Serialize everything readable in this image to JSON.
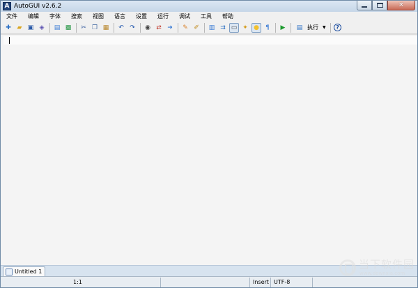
{
  "window": {
    "title": "AutoGUI v2.6.2",
    "app_icon": "A",
    "controls": {
      "minimize": "minimize-icon",
      "maximize": "maximize-icon",
      "close": "✕"
    }
  },
  "menu": {
    "items": [
      "文件",
      "编辑",
      "字体",
      "搜索",
      "视图",
      "语言",
      "设置",
      "运行",
      "调试",
      "工具",
      "帮助"
    ]
  },
  "toolbar": {
    "groups": [
      [
        {
          "name": "new-file-icon",
          "glyph": "✚",
          "color": "#2a6fc4"
        },
        {
          "name": "open-folder-icon",
          "glyph": "▰",
          "color": "#d9a520"
        },
        {
          "name": "save-icon",
          "glyph": "▣",
          "color": "#2b5aa8"
        },
        {
          "name": "save-all-icon",
          "glyph": "◈",
          "color": "#5a4fb0"
        }
      ],
      [
        {
          "name": "form-designer-icon",
          "glyph": "▤",
          "color": "#3a7bd5"
        },
        {
          "name": "import-icon",
          "glyph": "▩",
          "color": "#2f9a4b"
        }
      ],
      [
        {
          "name": "cut-icon",
          "glyph": "✂",
          "color": "#3a5fa0"
        },
        {
          "name": "copy-icon",
          "glyph": "❐",
          "color": "#4a6fa5"
        },
        {
          "name": "paste-icon",
          "glyph": "▦",
          "color": "#b8862b"
        }
      ],
      [
        {
          "name": "undo-icon",
          "glyph": "↶",
          "color": "#2a5db0"
        },
        {
          "name": "redo-icon",
          "glyph": "↷",
          "color": "#2a5db0"
        }
      ],
      [
        {
          "name": "find-icon",
          "glyph": "◉",
          "color": "#404040"
        },
        {
          "name": "replace-icon",
          "glyph": "⇄",
          "color": "#c0392b"
        },
        {
          "name": "goto-icon",
          "glyph": "➜",
          "color": "#3a7bd5"
        }
      ],
      [
        {
          "name": "highlight-icon",
          "glyph": "✎",
          "color": "#d9822b"
        },
        {
          "name": "marker-icon",
          "glyph": "✐",
          "color": "#c08a1e"
        }
      ],
      [
        {
          "name": "toggle-panel-icon",
          "glyph": "▥",
          "color": "#3a7bd5"
        },
        {
          "name": "word-wrap-icon",
          "glyph": "⇉",
          "color": "#2a6fc4"
        },
        {
          "name": "whitespace-icon",
          "glyph": "▭",
          "color": "#555555",
          "pressed": true
        },
        {
          "name": "extensions-icon",
          "glyph": "✦",
          "color": "#d49a1a"
        },
        {
          "name": "tip-icon",
          "glyph": "●",
          "color": "#f2c12e",
          "pressed": true
        },
        {
          "name": "paragraph-icon",
          "glyph": "¶",
          "color": "#3a7bd5"
        }
      ],
      [
        {
          "name": "run-icon",
          "glyph": "▶",
          "color": "#1c9a2e"
        }
      ]
    ],
    "run_button": {
      "icon": "execute-icon",
      "label": "执行",
      "arrow": "▼"
    },
    "help": {
      "name": "help-icon",
      "glyph": "?",
      "color": "#1e4fa0"
    }
  },
  "tabs": [
    {
      "label": "Untitled 1",
      "icon": "document-icon"
    }
  ],
  "status": {
    "position": "1:1",
    "mode": "Insert",
    "encoding": "UTF-8"
  },
  "watermark": {
    "title": "当下软件园",
    "url": "www.downxia.com"
  }
}
